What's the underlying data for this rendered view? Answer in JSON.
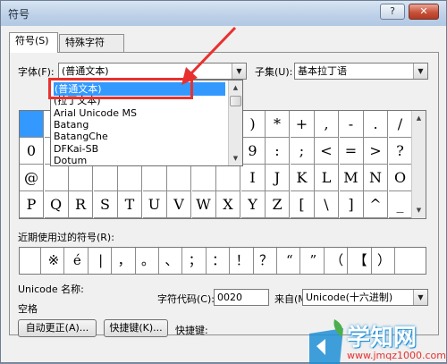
{
  "window": {
    "title": "符号",
    "help_label": "?",
    "close_label": "✕"
  },
  "tabs": [
    {
      "label": "符号(S)"
    },
    {
      "label": "特殊字符(P)"
    }
  ],
  "font": {
    "label": "字体(F):",
    "value": "(普通文本)"
  },
  "subset": {
    "label": "子集(U):",
    "value": "基本拉丁语"
  },
  "font_options": [
    "(普通文本)",
    "(拉丁文本)",
    "Arial Unicode MS",
    "Batang",
    "BatangChe",
    "DFKai-SB",
    "Dotum"
  ],
  "symbol_rows": [
    [
      "",
      "",
      "",
      "",
      "",
      "",
      "",
      "",
      "",
      ")",
      "*",
      "+",
      ",",
      "-",
      ".",
      "/"
    ],
    [
      "0",
      "",
      "",
      "",
      "",
      "",
      "",
      "",
      "",
      "9",
      ":",
      ";",
      "<",
      "=",
      ">",
      "?"
    ],
    [
      "@",
      "",
      "",
      "",
      "",
      "",
      "",
      "",
      "",
      "I",
      "J",
      "K",
      "L",
      "M",
      "N",
      "O"
    ],
    [
      "P",
      "Q",
      "R",
      "S",
      "T",
      "U",
      "V",
      "W",
      "X",
      "Y",
      "Z",
      "[",
      "\\",
      "]",
      "^",
      "_"
    ]
  ],
  "recent": {
    "label": "近期使用过的符号(R):",
    "symbols": [
      "",
      "※",
      "é",
      "|",
      "，",
      "。",
      "、",
      "；",
      "：",
      "！",
      "？",
      "“",
      "”",
      "（",
      "【",
      "）"
    ]
  },
  "unicode_name": {
    "label": "Unicode 名称:",
    "value": "空格"
  },
  "char_code": {
    "label": "字符代码(C):",
    "value": "0020"
  },
  "from": {
    "label": "来自(M):",
    "value": "Unicode(十六进制)"
  },
  "buttons": {
    "autocorrect": "自动更正(A)...",
    "shortcut": "快捷键(K)...",
    "shortcut_key_label": "快捷键:"
  },
  "watermark": {
    "brand": "学知网",
    "url": "www.jmqz1000.com"
  },
  "colors": {
    "selection": "#3399ff",
    "annotation": "#e8312f",
    "watermark": "#1f8fd6"
  }
}
